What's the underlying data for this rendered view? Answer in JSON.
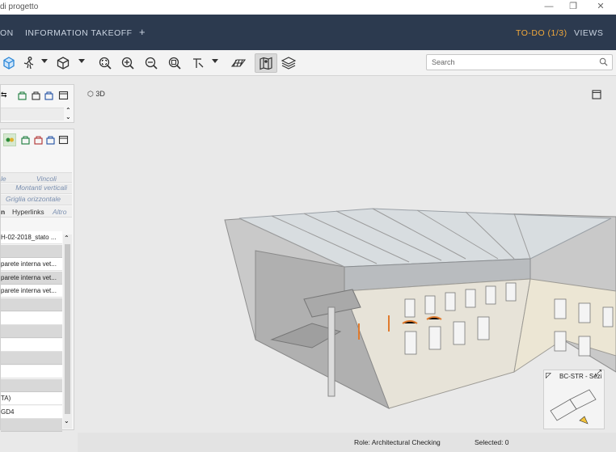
{
  "window": {
    "title": "di progetto"
  },
  "nav": {
    "left_item": "ON",
    "takeoff": "INFORMATION TAKEOFF",
    "add": "+",
    "todo": "TO-DO (1/3)",
    "views": "VIEWS"
  },
  "search": {
    "placeholder": "Search"
  },
  "viewport": {
    "mode_label": "3D",
    "minimap_title": "BC-STR - Sezi"
  },
  "left_panel": {
    "header_cols": [
      "le",
      "Vincoli"
    ],
    "category1": "Montanti verticali",
    "category2": "Griglia orizzontale",
    "tabs": [
      "n",
      "Hyperlinks",
      "Altro"
    ],
    "rows": [
      {
        "text": "H-02-2018_stato ...",
        "style": "w"
      },
      {
        "text": "",
        "style": "g"
      },
      {
        "text": "parete interna vet...",
        "style": "w"
      },
      {
        "text": "parete interna vet...",
        "style": "g"
      },
      {
        "text": "parete interna vet...",
        "style": "w"
      },
      {
        "text": "",
        "style": "g"
      },
      {
        "text": "",
        "style": "w"
      },
      {
        "text": "",
        "style": "g"
      },
      {
        "text": "",
        "style": "w"
      },
      {
        "text": "",
        "style": "g"
      },
      {
        "text": "",
        "style": "w"
      },
      {
        "text": "",
        "style": "g"
      },
      {
        "text": "TA)",
        "style": "w"
      },
      {
        "text": "GD4",
        "style": "w"
      },
      {
        "text": "",
        "style": "g"
      }
    ]
  },
  "status": {
    "role": "Role: Architectural Checking",
    "selected": "Selected: 0"
  },
  "icons": {
    "toolbar": [
      "cube-blue-icon",
      "walk-icon",
      "cube-icon",
      "zoom-fit-icon",
      "zoom-in-icon",
      "zoom-out-icon",
      "zoom-window-icon",
      "section-icon",
      "plane-icon",
      "map-icon",
      "layers-icon"
    ]
  }
}
